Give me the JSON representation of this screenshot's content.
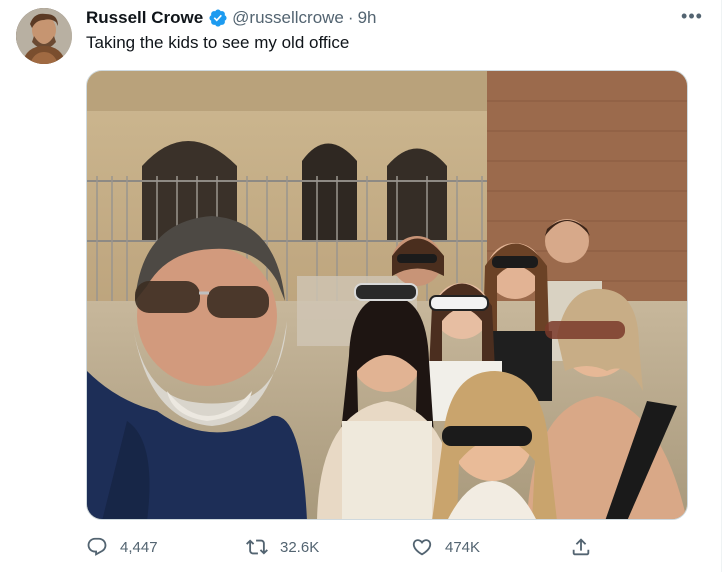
{
  "author": {
    "display_name": "Russell Crowe",
    "handle": "@russellcrowe",
    "separator": "·",
    "timestamp": "9h",
    "verified": true
  },
  "tweet": {
    "text": "Taking the kids to see my old office"
  },
  "media": {
    "description_icon": "photo"
  },
  "actions": {
    "reply_count": "4,447",
    "retweet_count": "32.6K",
    "like_count": "474K"
  },
  "more_label": "•••",
  "colors": {
    "verified": "#1d9bf0",
    "secondary_text": "#536471",
    "primary_text": "#0f1419"
  }
}
